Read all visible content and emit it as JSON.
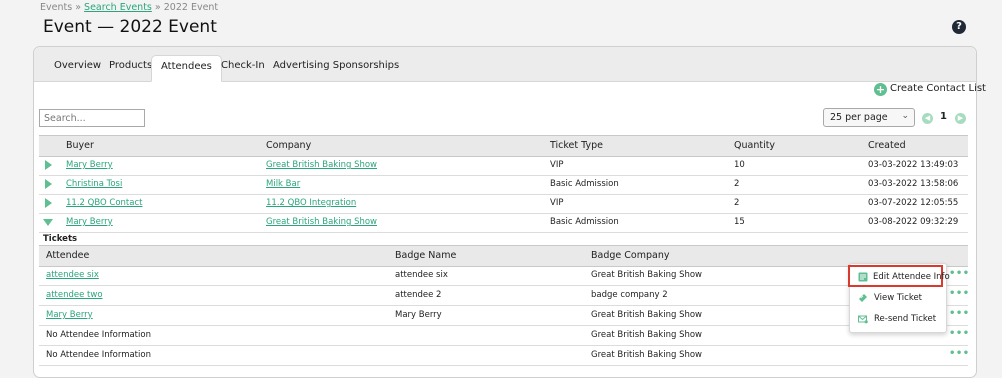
{
  "breadcrumb": {
    "events": "Events",
    "sep1": "»",
    "search_events": "Search Events",
    "sep2": "»",
    "current": "2022 Event"
  },
  "page": {
    "title": "Event — 2022 Event",
    "help": "?"
  },
  "tabs": [
    "Overview",
    "Products",
    "Attendees",
    "Check-In",
    "Advertising Sponsorships"
  ],
  "active_tab": "Attendees",
  "toolbar": {
    "create_label": "Create Contact List",
    "search_placeholder": "Search...",
    "per_page": "25 per page",
    "page_number": "1"
  },
  "orders": {
    "headers": [
      "Buyer",
      "Company",
      "Ticket Type",
      "Quantity",
      "Created"
    ],
    "rows": [
      {
        "buyer": "Mary Berry",
        "company": "Great British Baking Show",
        "ticket_type": "VIP",
        "quantity": "10",
        "created": "03-03-2022 13:49:03"
      },
      {
        "buyer": "Christina Tosi",
        "company": "Milk Bar",
        "ticket_type": "Basic Admission",
        "quantity": "2",
        "created": "03-03-2022 13:58:06"
      },
      {
        "buyer": "11.2 QBO Contact",
        "company": "11.2 QBO Integration",
        "ticket_type": "VIP",
        "quantity": "2",
        "created": "03-07-2022 12:05:55"
      },
      {
        "buyer": "Mary Berry",
        "company": "Great British Baking Show",
        "ticket_type": "Basic Admission",
        "quantity": "15",
        "created": "03-08-2022 09:32:29"
      }
    ]
  },
  "tickets": {
    "label": "Tickets",
    "headers": [
      "Attendee",
      "Badge Name",
      "Badge Company"
    ],
    "rows": [
      {
        "attendee": "attendee six",
        "badge_name": "attendee six",
        "badge_company": "Great British Baking Show"
      },
      {
        "attendee": "attendee two",
        "badge_name": "attendee 2",
        "badge_company": "badge company 2"
      },
      {
        "attendee": "Mary Berry",
        "badge_name": "Mary Berry",
        "badge_company": "Great British Baking Show"
      },
      {
        "attendee": "No Attendee Information",
        "badge_name": "",
        "badge_company": "Great British Baking Show"
      },
      {
        "attendee": "No Attendee Information",
        "badge_name": "",
        "badge_company": "Great British Baking Show"
      }
    ],
    "actions_glyph": "•••"
  },
  "context_menu": {
    "items": [
      {
        "label": "Edit Attendee Info",
        "icon": "edit-form-icon"
      },
      {
        "label": "View Ticket",
        "icon": "ticket-icon"
      },
      {
        "label": "Re-send Ticket",
        "icon": "resend-mail-icon"
      }
    ],
    "highlight_color": "#d93a2d"
  },
  "colors": {
    "accent": "#5fbf90",
    "link": "#2aa57d",
    "header_bg": "#e9e9e9"
  }
}
